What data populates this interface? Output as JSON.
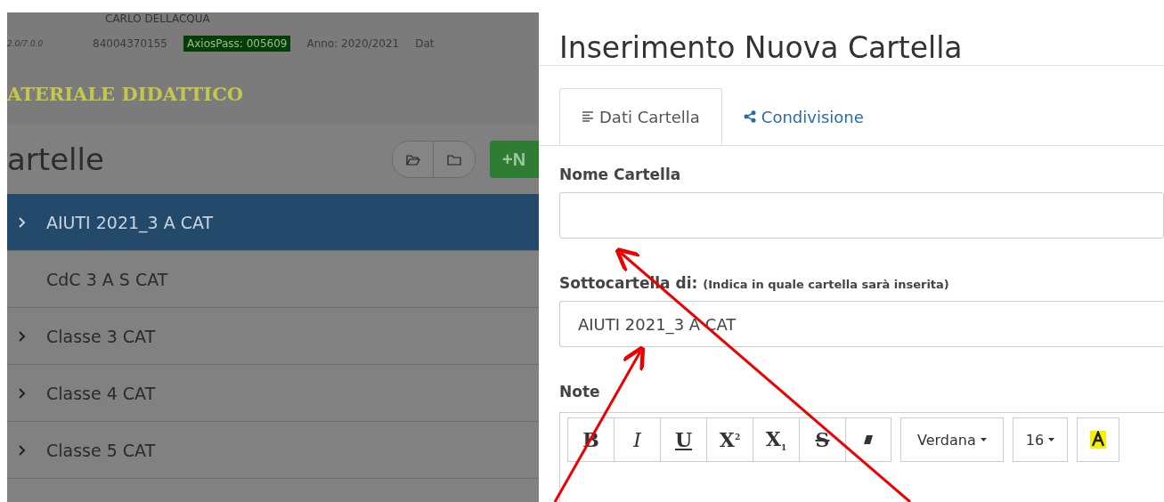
{
  "background_page": {
    "user_name": "CARLO DELLACQUA",
    "version": "2.0/7.0.0",
    "code": "84004370155",
    "axios_pass": "AxiosPass: 005609",
    "year": "Anno: 2020/2021",
    "date_cut": "Dat",
    "section_title": "ATERIALE DIDATTICO",
    "heading": "artelle",
    "new_button": "+N",
    "folders": [
      {
        "label": "AIUTI 2021_3 A CAT",
        "expandable": true,
        "selected": true
      },
      {
        "label": "CdC 3 A S CAT",
        "expandable": false,
        "selected": false
      },
      {
        "label": "Classe 3 CAT",
        "expandable": true,
        "selected": false
      },
      {
        "label": "Classe 4 CAT",
        "expandable": true,
        "selected": false
      },
      {
        "label": "Classe 5 CAT",
        "expandable": true,
        "selected": false
      }
    ]
  },
  "modal": {
    "title": "Inserimento Nuova Cartella",
    "tabs": [
      {
        "label": "Dati Cartella",
        "selected": true
      },
      {
        "label": "Condivisione",
        "selected": false
      }
    ],
    "name_label": "Nome Cartella",
    "parent_label": "Sottocartella di:",
    "parent_hint": "(Indica in quale cartella sarà inserita)",
    "parent_value": "AIUTI 2021_3 A CAT",
    "notes_label": "Note",
    "toolbar": [
      {
        "kind": "bold",
        "label": "B"
      },
      {
        "kind": "italic",
        "label": "I"
      },
      {
        "kind": "underline",
        "label": "U"
      },
      {
        "kind": "sup",
        "label": "X$^{2}$"
      },
      {
        "kind": "sub",
        "label": "X$_{1}$"
      },
      {
        "kind": "strike",
        "label": "S"
      },
      {
        "kind": "eraser"
      }
    ],
    "font": "Verdana",
    "size": "16"
  }
}
